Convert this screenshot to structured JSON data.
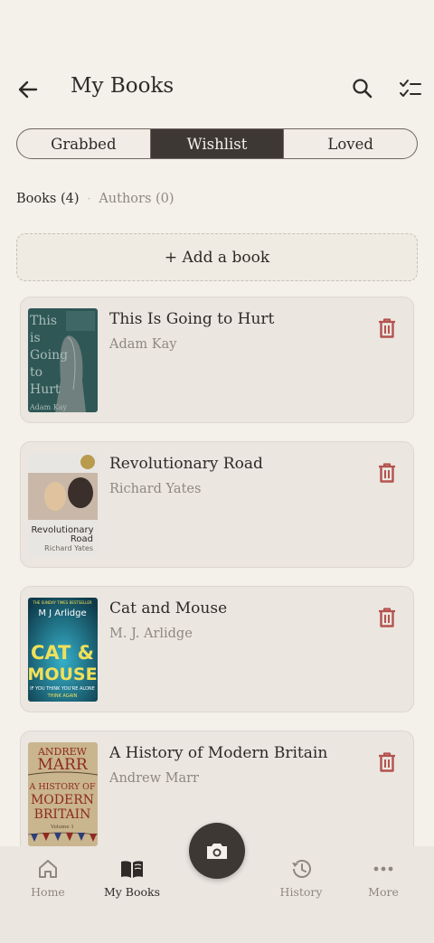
{
  "header": {
    "title": "My Books",
    "back_icon": "arrow-left-icon",
    "search_icon": "search-icon",
    "checklist_icon": "checklist-icon"
  },
  "tabs": [
    {
      "label": "Grabbed",
      "active": false
    },
    {
      "label": "Wishlist",
      "active": true
    },
    {
      "label": "Loved",
      "active": false
    }
  ],
  "filters": {
    "books": "Books (4)",
    "separator": "·",
    "authors": "Authors (0)"
  },
  "add_book": {
    "label": "+ Add a book"
  },
  "books": [
    {
      "title": "This Is Going to Hurt",
      "author": "Adam Kay",
      "cover": {
        "lines": [
          "This",
          "is",
          "Going",
          "to",
          "Hurt"
        ],
        "author": "Adam Kay",
        "color": "#2f5756"
      }
    },
    {
      "title": "Revolutionary Road",
      "author": "Richard Yates",
      "cover": {
        "lines": [
          "Revolutionary",
          "Road"
        ],
        "author": "Richard Yates",
        "color": "#e8e6e3"
      }
    },
    {
      "title": "Cat and Mouse",
      "author": "M. J. Arlidge",
      "cover": {
        "top": "THE SUNDAY TIMES BESTSELLER",
        "author": "M J Arlidge",
        "lines": [
          "CAT &",
          "MOUSE"
        ],
        "tagline": "IF YOU THINK YOU'RE ALONE",
        "tagline2": "THINK AGAIN",
        "color": "#1a6f86"
      }
    },
    {
      "title": "A History of Modern Britain",
      "author": "Andrew Marr",
      "cover": {
        "author_first": "ANDREW",
        "author_last": "MARR",
        "lines": [
          "A HISTORY OF",
          "MODERN",
          "BRITAIN"
        ],
        "volume": "Volume 1",
        "color": "#c9b58e"
      }
    }
  ],
  "bottom_nav": {
    "items": [
      {
        "label": "Home",
        "icon": "home-icon",
        "active": false
      },
      {
        "label": "My Books",
        "icon": "open-book-icon",
        "active": true
      },
      {
        "label": "History",
        "icon": "history-icon",
        "active": false
      },
      {
        "label": "More",
        "icon": "more-dots-icon",
        "active": false
      }
    ],
    "fab_icon": "camera-icon"
  },
  "colors": {
    "background": "#f4f0ea",
    "accent_dark": "#3e3835",
    "delete": "#b5524f",
    "card": "#ebe6e0"
  }
}
